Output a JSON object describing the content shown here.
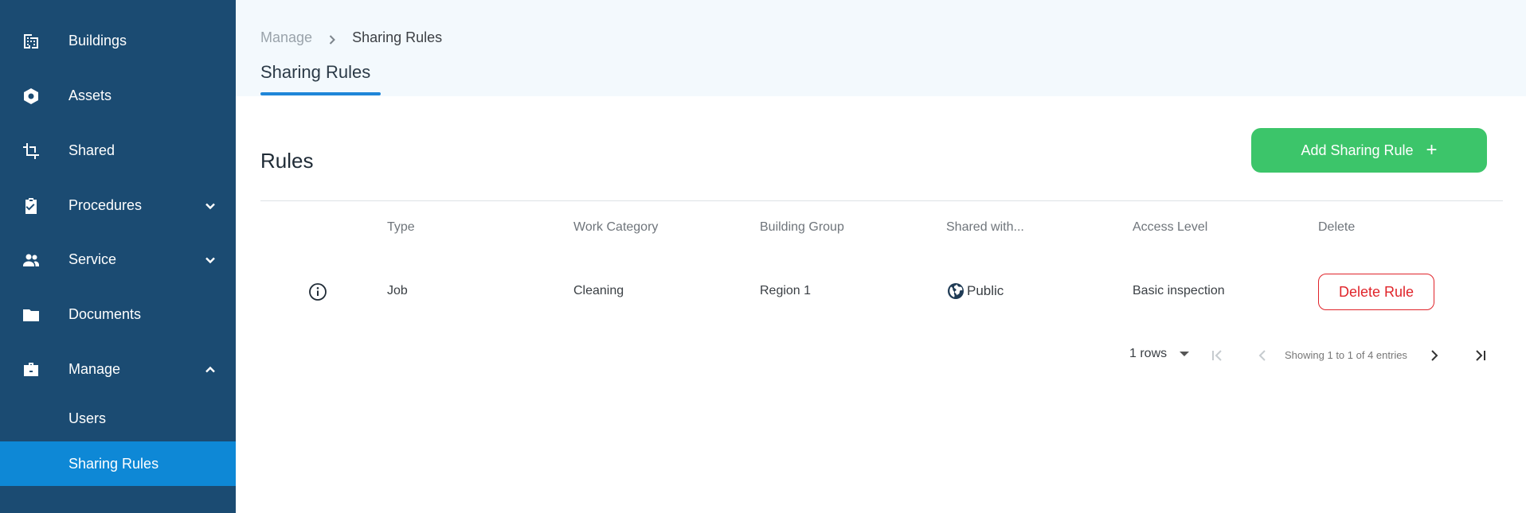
{
  "sidebar": {
    "items": [
      {
        "label": "Buildings",
        "icon": "building-icon"
      },
      {
        "label": "Assets",
        "icon": "hexagon-icon"
      },
      {
        "label": "Shared",
        "icon": "crop-icon"
      },
      {
        "label": "Procedures",
        "icon": "clipboard-check-icon",
        "expandable": true,
        "expanded": false
      },
      {
        "label": "Service",
        "icon": "people-icon",
        "expandable": true,
        "expanded": false
      },
      {
        "label": "Documents",
        "icon": "folder-icon"
      },
      {
        "label": "Manage",
        "icon": "briefcase-icon",
        "expandable": true,
        "expanded": true
      }
    ],
    "sub_items": [
      {
        "label": "Users",
        "active": false
      },
      {
        "label": "Sharing Rules",
        "active": true
      }
    ]
  },
  "breadcrumb": {
    "parent": "Manage",
    "current": "Sharing Rules"
  },
  "page": {
    "title": "Sharing Rules",
    "section_title": "Rules",
    "add_button_label": "Add Sharing Rule"
  },
  "table": {
    "columns": [
      "Type",
      "Work Category",
      "Building Group",
      "Shared with...",
      "Access Level",
      "Delete"
    ],
    "rows": [
      {
        "type": "Job",
        "work_category": "Cleaning",
        "building_group": "Region 1",
        "shared_with": "Public",
        "access_level": "Basic inspection",
        "delete_label": "Delete Rule"
      }
    ]
  },
  "pagination": {
    "rows_label": "1 rows",
    "info": "Showing 1 to 1 of 4 entries"
  },
  "colors": {
    "sidebar_bg": "#1b4b72",
    "sidebar_active": "#0e88d6",
    "accent_blue": "#1f86d8",
    "add_button": "#3cc56a",
    "delete_red": "#e0242a"
  }
}
